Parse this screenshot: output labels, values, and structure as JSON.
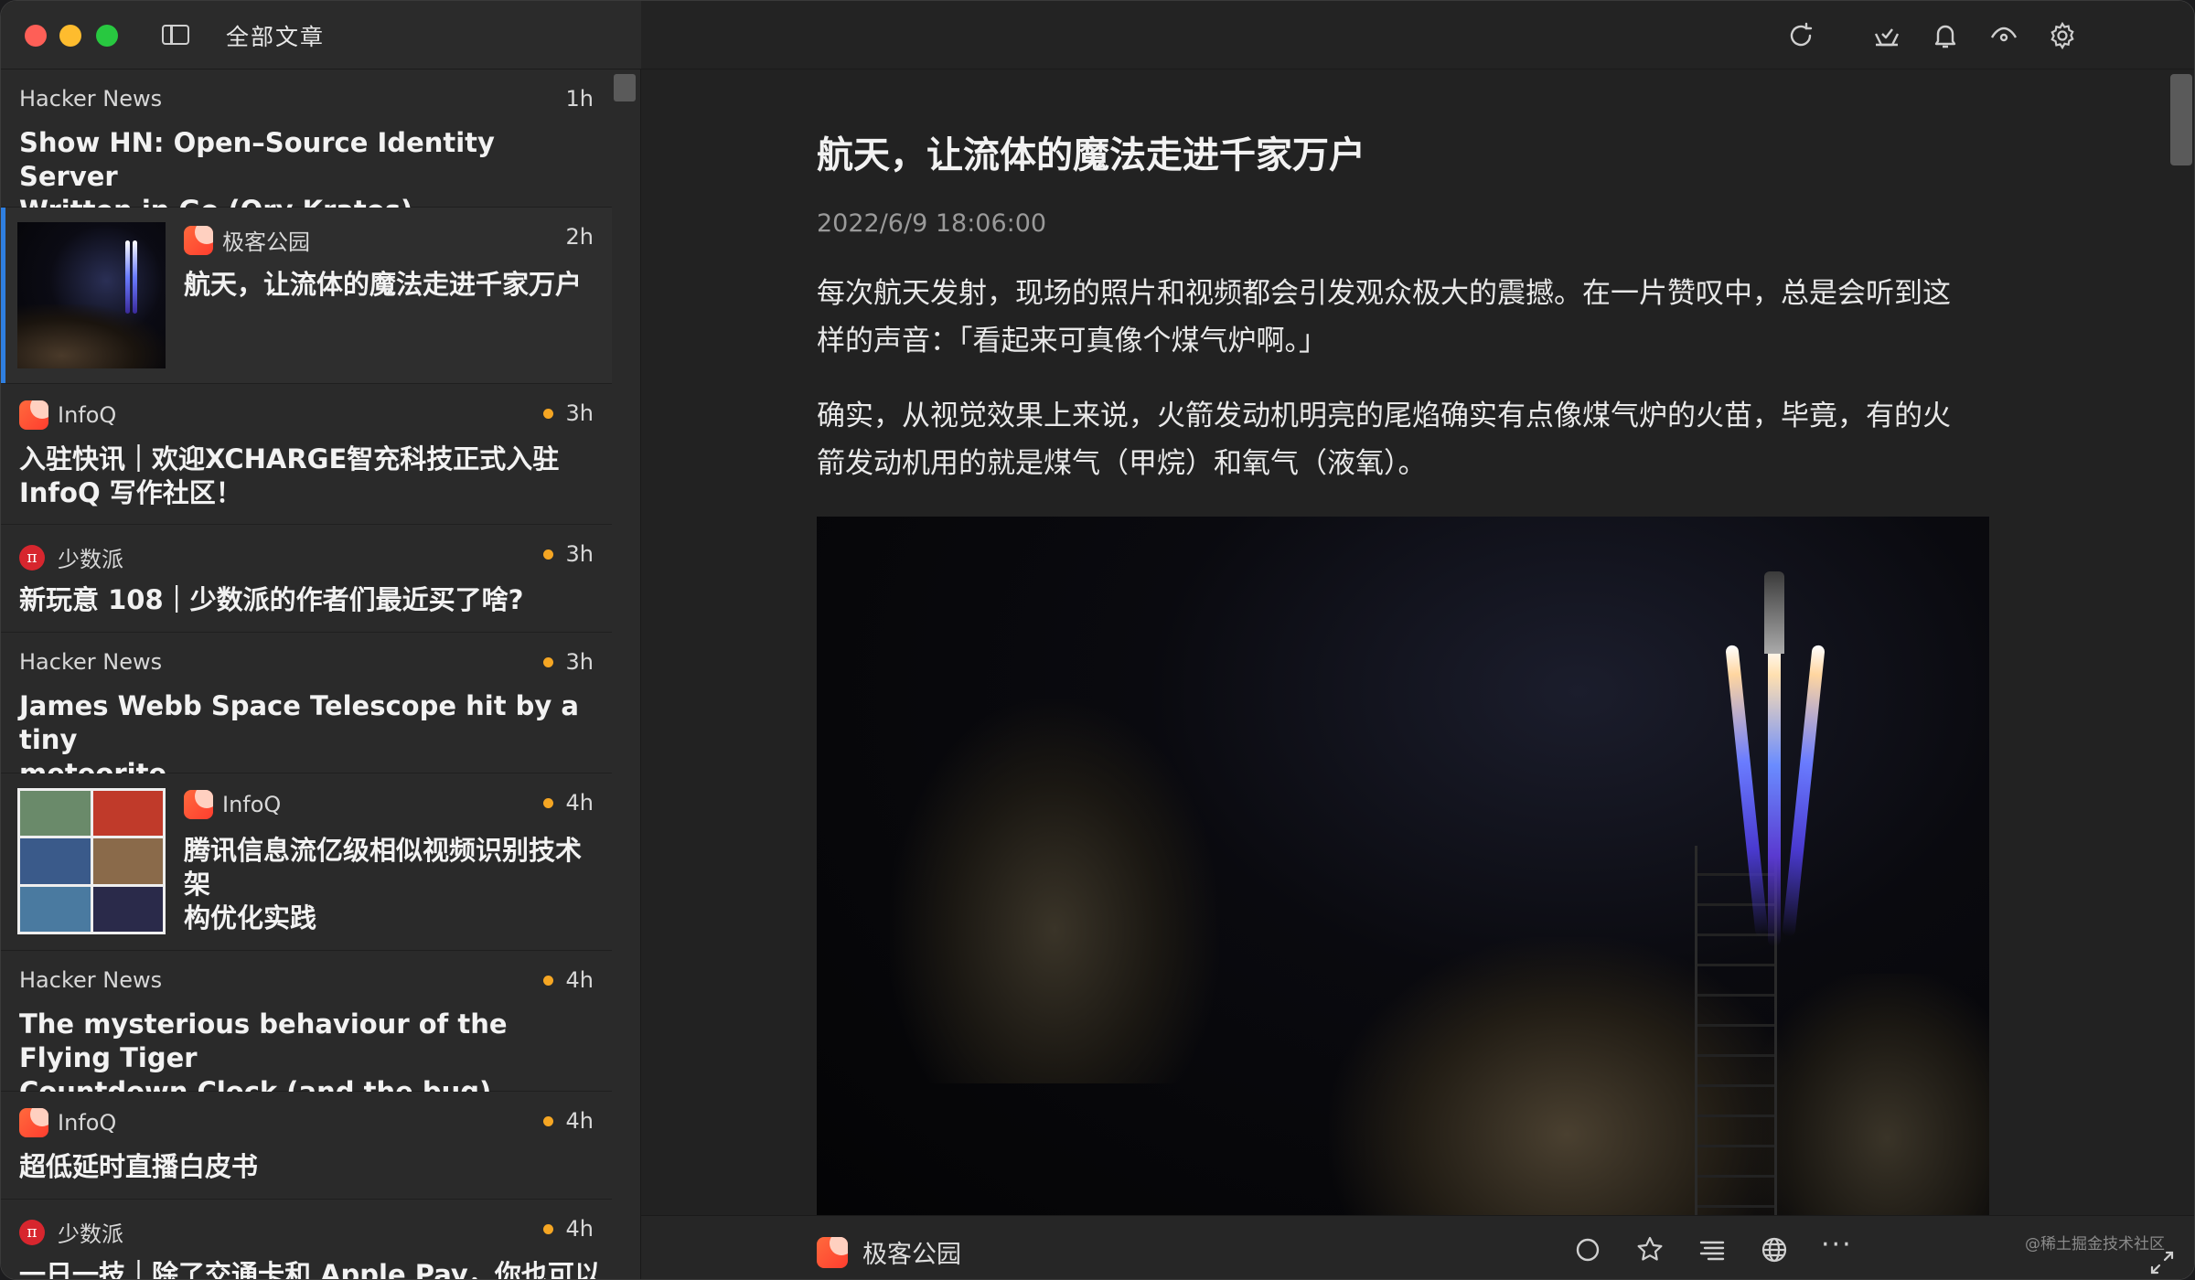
{
  "header": {
    "title": "全部文章"
  },
  "articles": [
    {
      "source": "Hacker News",
      "time": "1h",
      "title_lines": [
        "Show HN: Open–Source Identity Server",
        "Written in Go (Ory Kratos)"
      ]
    },
    {
      "source": "极客公园",
      "time": "2h",
      "title_lines": [
        "航天，让流体的魔法走进千家万户"
      ]
    },
    {
      "source": "InfoQ",
      "time": "3h",
      "title_lines": [
        "入驻快讯｜欢迎XCHARGE智充科技正式入驻",
        "InfoQ 写作社区！"
      ]
    },
    {
      "source": "少数派",
      "time": "3h",
      "title_lines": [
        "新玩意 108｜少数派的作者们最近买了啥?"
      ]
    },
    {
      "source": "Hacker News",
      "time": "3h",
      "title_lines": [
        "James Webb Space Telescope hit by a tiny",
        "meteorite"
      ]
    },
    {
      "source": "InfoQ",
      "time": "4h",
      "title_lines": [
        "腾讯信息流亿级相似视频识别技术架",
        "构优化实践"
      ]
    },
    {
      "source": "Hacker News",
      "time": "4h",
      "title_lines": [
        "The mysterious behaviour of the Flying Tiger",
        "Countdown Clock (and the bug)"
      ]
    },
    {
      "source": "InfoQ",
      "time": "4h",
      "title_lines": [
        "超低延时直播白皮书"
      ]
    },
    {
      "source": "少数派",
      "time": "4h",
      "title_lines": [
        "一日一技｜除了交通卡和 Apple Pay，你也可以自"
      ]
    }
  ],
  "sspai_glyph": "π",
  "article": {
    "title": "航天，让流体的魔法走进千家万户",
    "date": "2022/6/9 18:06:00",
    "paragraphs": [
      [
        "每次航天发射，现场的照片和视频都会引发观众极大的震撼。在一片赞叹中，总是会听到这",
        "样的声音：「看起来可真像个煤气炉啊。」"
      ],
      [
        "确实，从视觉效果上来说，火箭发动机明亮的尾焰确实有点像煤气炉的火苗，毕竟，有的火",
        "箭发动机用的就是煤气（甲烷）和氧气（液氧）。"
      ]
    ]
  },
  "footer": {
    "source": "极客公园",
    "more": "···",
    "watermark": "@稀土掘金技术社区"
  },
  "colors": {
    "accent": "#2f7fe0",
    "unread_dot": "#f5a623",
    "infoq": "#ff4d32",
    "sspai": "#d7262e"
  }
}
